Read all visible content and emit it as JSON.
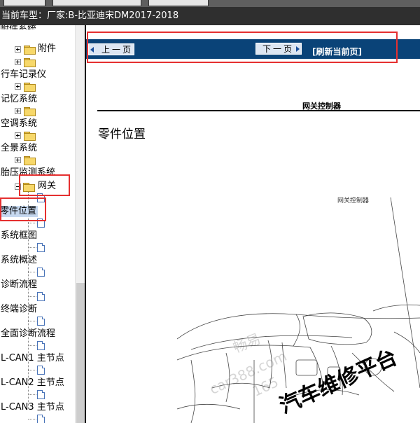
{
  "window": {
    "car_label": "当前车型：",
    "car_value": "厂家:B-比亚迪宋DM2017-2018"
  },
  "tree": {
    "partial_top": "附件",
    "items": [
      {
        "label": "附件"
      },
      {
        "label": "行车记录仪"
      },
      {
        "label": "记忆系统"
      },
      {
        "label": "空调系统"
      },
      {
        "label": "全景系统"
      },
      {
        "label": "胎压监测系统"
      },
      {
        "label": "网关"
      },
      {
        "label": "零件位置"
      },
      {
        "label": "系统框图"
      },
      {
        "label": "系统概述"
      },
      {
        "label": "诊断流程"
      },
      {
        "label": "终端诊断"
      },
      {
        "label": "全面诊断流程"
      },
      {
        "label": "L-CAN1 主节点"
      },
      {
        "label": "L-CAN2 主节点"
      },
      {
        "label": "L-CAN3 主节点"
      }
    ]
  },
  "nav": {
    "prev_label": "上一页",
    "next_label": "下一页",
    "refresh_label": "[刷新当前页]"
  },
  "document": {
    "header_title": "网关控制器",
    "heading": "零件位置",
    "callout_label": "网关控制器"
  },
  "watermark": {
    "line1": "畅易",
    "line2": "car388.com",
    "line3": "汽车维修平台",
    "line4": "165"
  },
  "colors": {
    "nav_bar": "#0a4378",
    "highlight_box": "#e53030",
    "selected_item": "#c6d8ef"
  }
}
